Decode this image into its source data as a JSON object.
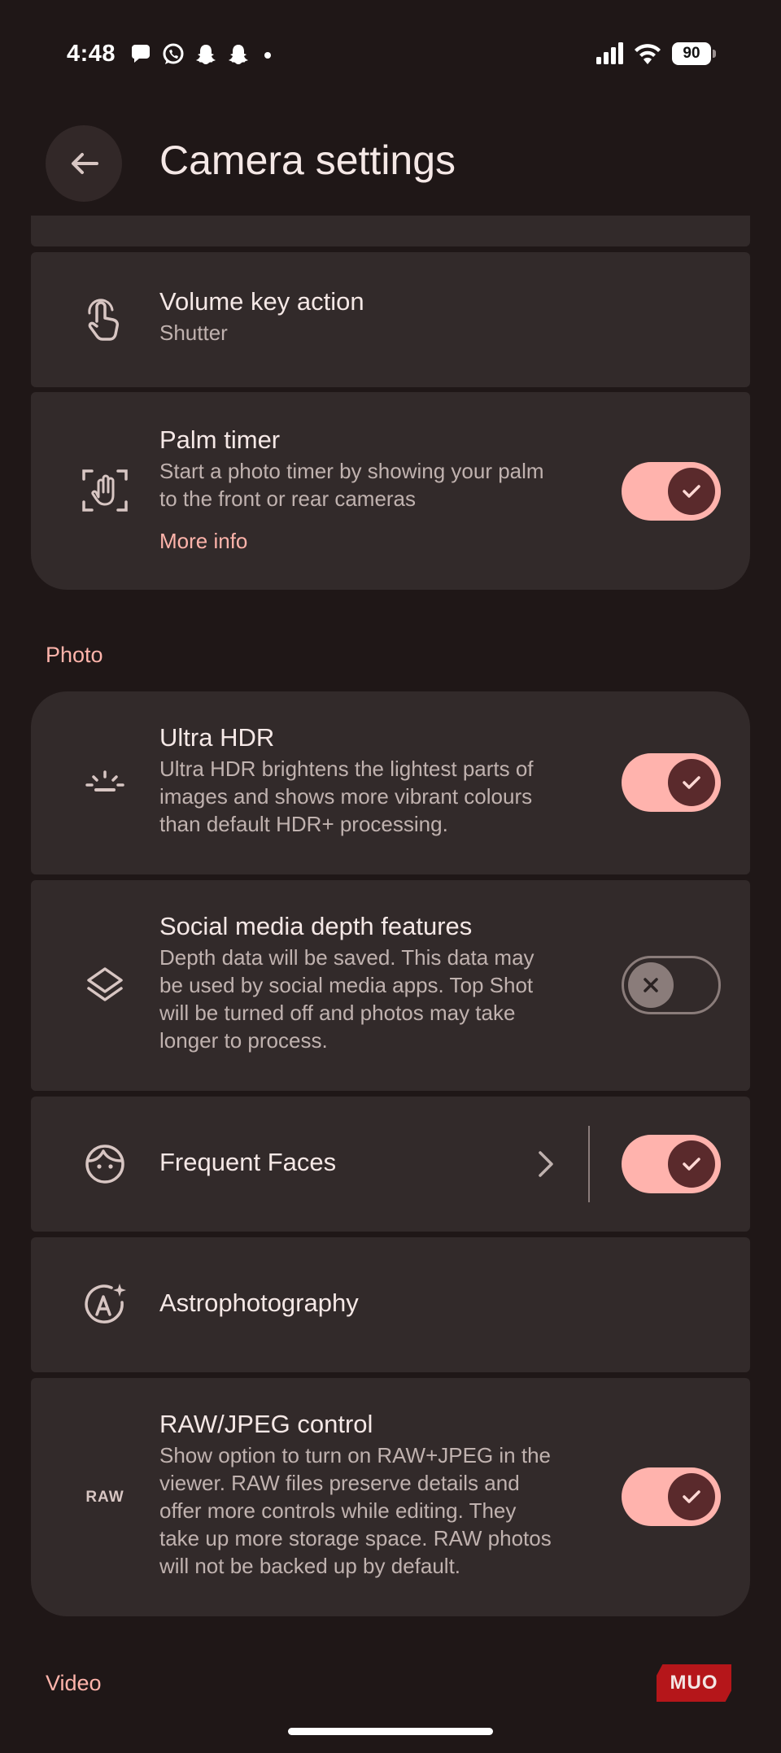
{
  "status_bar": {
    "time": "4:48",
    "battery": "90",
    "notification_icons": [
      "chat-icon",
      "whatsapp-icon",
      "snapchat-icon",
      "snapchat-icon",
      "dot-icon"
    ],
    "system_icons": [
      "signal-icon",
      "wifi-icon",
      "battery-icon"
    ]
  },
  "header": {
    "title": "Camera settings",
    "back_icon": "arrow-back-icon"
  },
  "rows": {
    "volume_key": {
      "title": "Volume key action",
      "subtitle": "Shutter",
      "icon": "touch-icon"
    },
    "palm_timer": {
      "title": "Palm timer",
      "subtitle_line1": "Start a photo timer by showing your palm",
      "subtitle_line2": "to the front or rear cameras",
      "link": "More info",
      "enabled": true,
      "icon": "palm-icon"
    },
    "ultra_hdr": {
      "title": "Ultra HDR",
      "subtitle_line1": "Ultra HDR brightens the lightest parts of",
      "subtitle_line2": "images and shows more vibrant colours",
      "subtitle_line3": "than default HDR+ processing.",
      "enabled": true,
      "icon": "hdr-sun-icon"
    },
    "social_depth": {
      "title": "Social media depth features",
      "subtitle_line1": "Depth data will be saved. This data may",
      "subtitle_line2": "be used by social media apps. Top Shot",
      "subtitle_line3": "will be turned off and photos may take",
      "subtitle_line4": "longer to process.",
      "enabled": false,
      "icon": "layers-icon"
    },
    "frequent_faces": {
      "title": "Frequent Faces",
      "enabled": true,
      "icon": "face-icon"
    },
    "astro": {
      "title": "Astrophotography",
      "icon": "astro-icon"
    },
    "raw_jpeg": {
      "title": "RAW/JPEG control",
      "subtitle_line1": "Show option to turn on RAW+JPEG in the",
      "subtitle_line2": "viewer. RAW files preserve details and",
      "subtitle_line3": "offer more controls while editing. They",
      "subtitle_line4": "take up more storage space. RAW photos",
      "subtitle_line5": "will not be backed up by default.",
      "icon_label": "RAW",
      "enabled": true
    }
  },
  "sections": {
    "photo": "Photo",
    "video": "Video"
  },
  "watermark": "MUO",
  "colors": {
    "background": "#1f1717",
    "card": "#322a2a",
    "accent": "#ffb4ab",
    "toggle_on": "#ffb3ad",
    "knob_on": "#5a2a2c"
  }
}
